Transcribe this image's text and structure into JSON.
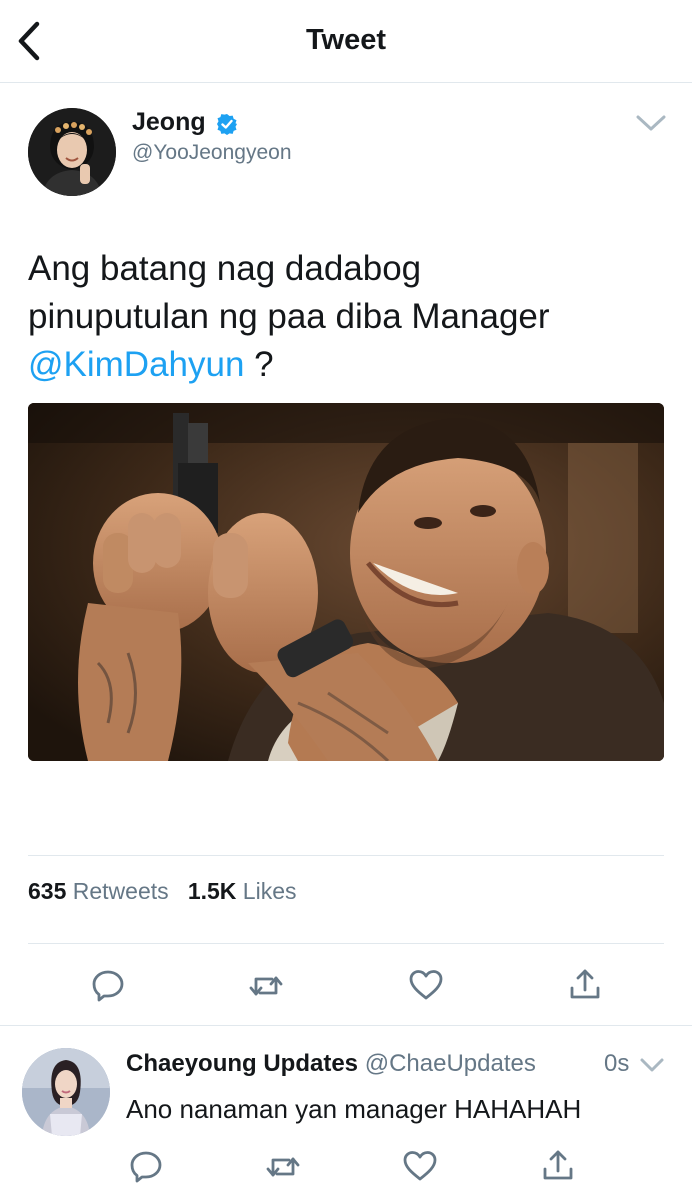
{
  "header": {
    "title": "Tweet"
  },
  "tweet": {
    "author_name": "Jeong",
    "author_handle": "@YooJeongyeon",
    "text_line1": "Ang batang nag dadabog",
    "text_line2": "pinuputulan ng paa diba Manager",
    "mention": "@KimDahyun",
    "text_after_mention": " ?",
    "retweets_count": "635",
    "retweets_label": "Retweets",
    "likes_count": "1.5K",
    "likes_label": "Likes"
  },
  "reply": {
    "author_name": "Chaeyoung Updates",
    "author_handle": "@ChaeUpdates",
    "time": "0s",
    "text": "Ano nanaman yan manager HAHAHAH"
  },
  "icons": {
    "back": "chevron-left-icon",
    "verified": "verified-badge-icon",
    "more": "chevron-down-icon",
    "reply": "reply-icon",
    "retweet": "retweet-icon",
    "like": "heart-icon",
    "share": "share-icon"
  },
  "colors": {
    "link": "#1da1f2",
    "secondary_text": "#657786",
    "primary_text": "#14171a",
    "divider": "#e1e8ed"
  }
}
